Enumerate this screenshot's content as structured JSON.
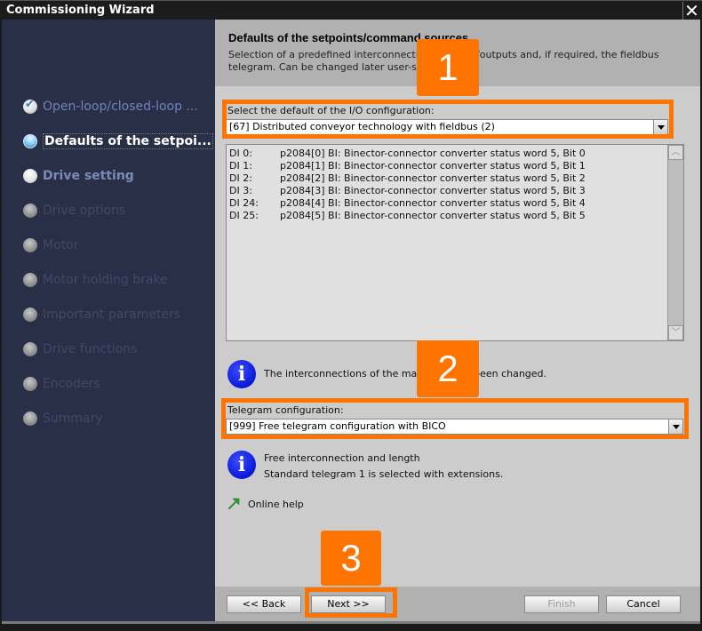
{
  "window": {
    "title": "Commissioning Wizard",
    "close_icon": "close-icon"
  },
  "sidebar": {
    "steps": [
      {
        "label": "Open-loop/closed-loop ...",
        "state": "done"
      },
      {
        "label": "Defaults of the setpoi...",
        "state": "active"
      },
      {
        "label": "Drive setting",
        "state": "next"
      },
      {
        "label": "Drive options",
        "state": "disabled"
      },
      {
        "label": "Motor",
        "state": "disabled"
      },
      {
        "label": "Motor holding brake",
        "state": "disabled"
      },
      {
        "label": "Important parameters",
        "state": "disabled"
      },
      {
        "label": "Drive functions",
        "state": "disabled"
      },
      {
        "label": "Encoders",
        "state": "disabled"
      },
      {
        "label": "Summary",
        "state": "disabled"
      }
    ]
  },
  "header": {
    "title": "Defaults of the setpoints/command sources",
    "description": "Selection of a predefined interconnection of inputs/outputs and, if required, the fieldbus telegram. Can be changed later user-specifically."
  },
  "io_config": {
    "label": "Select the default of the I/O configuration:",
    "value": "[67] Distributed conveyor technology with fieldbus (2)"
  },
  "interconnections": [
    {
      "input": "DI 0:",
      "param": "p2084[0] BI: Binector-connector converter status word 5, Bit 0"
    },
    {
      "input": "DI 1:",
      "param": "p2084[1] BI: Binector-connector converter status word 5, Bit 1"
    },
    {
      "input": "DI 2:",
      "param": "p2084[2] BI: Binector-connector converter status word 5, Bit 2"
    },
    {
      "input": "DI 3:",
      "param": "p2084[3] BI: Binector-connector converter status word 5, Bit 3"
    },
    {
      "input": "DI 24:",
      "param": "p2084[4] BI: Binector-connector converter status word 5, Bit 4"
    },
    {
      "input": "DI 25:",
      "param": "p2084[5] BI: Binector-connector converter status word 5, Bit 5"
    }
  ],
  "info1": {
    "text": "The interconnections of the machine have been changed."
  },
  "telegram": {
    "label": "Telegram configuration:",
    "value": "[999] Free telegram configuration with BICO"
  },
  "info2": {
    "line1": "Free interconnection and length",
    "line2": "Standard telegram 1 is selected with extensions."
  },
  "help": {
    "label": "Online help"
  },
  "buttons": {
    "back": "<< Back",
    "next": "Next >>",
    "finish": "Finish",
    "cancel": "Cancel"
  },
  "annotations": {
    "badge1": "1",
    "badge2": "2",
    "badge3": "3",
    "highlight_color": "#ff7300"
  }
}
